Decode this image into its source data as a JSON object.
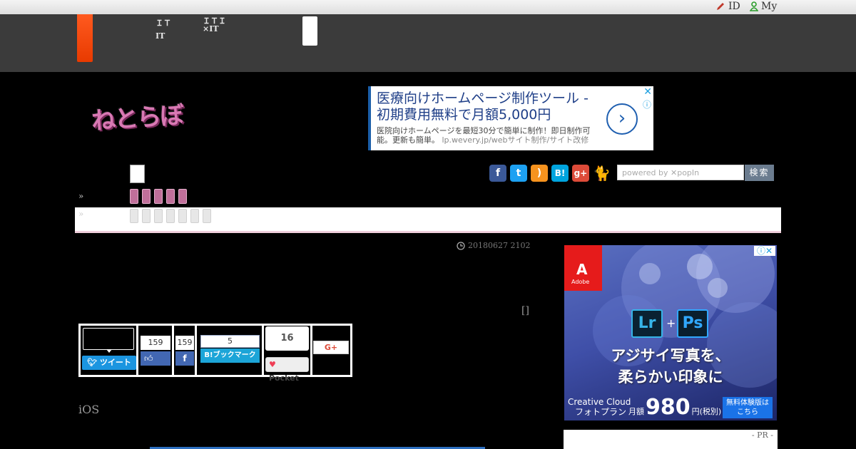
{
  "topbar": {
    "links": [
      {
        "label": "ID",
        "icon": "pencil-icon"
      },
      {
        "label": "My",
        "icon": "user-icon"
      }
    ]
  },
  "header": {
    "nav": [
      {
        "line1": "ＩＴ",
        "line2": "IT"
      },
      {
        "line1": "ＩＴＩ",
        "line2": "×IT"
      }
    ]
  },
  "logo": {
    "text": "ねとらぼ"
  },
  "banner_ad": {
    "title": "医療向けホームページ制作ツール - 初期費用無料で月額5,000円",
    "desc": "医院向けホームページを最短30分で簡単に制作！即日制作可能。更新も簡単。",
    "url": "lp.wevery.jp/webサイト制作/サイト改修"
  },
  "social": [
    "facebook-icon",
    "twitter-icon",
    "rss-icon",
    "hatena-icon",
    "google-plus-icon",
    "cat-icon"
  ],
  "search": {
    "placeholder": "powered by ✕popIn",
    "button": "検索"
  },
  "nav_rows": {
    "raquo": "»"
  },
  "article": {
    "datetime": "20180627 2102",
    "bracket": "[]",
    "ios_text": "iOS"
  },
  "share": {
    "tweet_label": "ツイート",
    "fb_like_count": "159",
    "fb_share_count": "159",
    "hatena_count": "5",
    "hatena_label": "B!ブックマーク",
    "pocket_count": "16",
    "pocket_label": "Pocket",
    "gplus_label": "G+"
  },
  "side_ad": {
    "brand": "Adobe",
    "app1": "Lr",
    "app2": "Ps",
    "headline1": "アジサイ写真を、",
    "headline2": "柔らかい印象に",
    "product1": "Creative Cloud",
    "product2": "フォトプラン",
    "price_prefix": "月額",
    "price": "980",
    "price_suffix": "円(税別)",
    "cta": "無料体験版は\nこちら"
  },
  "pr_label": "- PR -",
  "colors": {
    "header": "#3b3b3b",
    "orange": "#ff5a1f",
    "pink": "#c06f9a",
    "accent_blue": "#1f5fb0"
  }
}
